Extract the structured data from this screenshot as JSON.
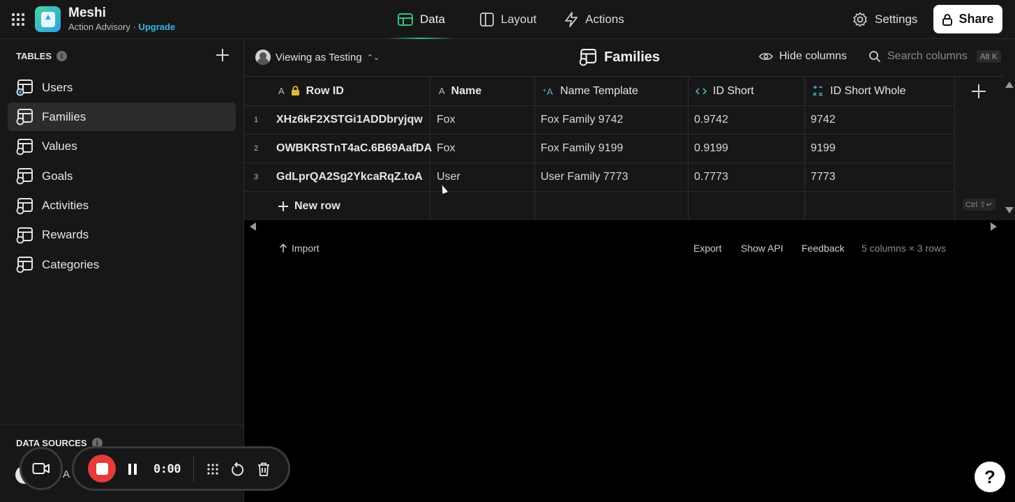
{
  "app": {
    "name": "Meshi",
    "subtitle": "Action Advisory",
    "separator": "·",
    "upgrade": "Upgrade"
  },
  "nav": {
    "data": "Data",
    "layout": "Layout",
    "actions": "Actions",
    "settings": "Settings",
    "share": "Share"
  },
  "sidebar": {
    "tables_label": "TABLES",
    "info": "i",
    "tables": [
      {
        "label": "Users"
      },
      {
        "label": "Families",
        "active": true
      },
      {
        "label": "Values"
      },
      {
        "label": "Goals"
      },
      {
        "label": "Activities"
      },
      {
        "label": "Rewards"
      },
      {
        "label": "Categories"
      }
    ],
    "data_sources_label": "DATA SOURCES",
    "data_source_name": "on A"
  },
  "toolbar": {
    "viewing_as": "Viewing as Testing",
    "updown": "⌃⌄",
    "title": "Families",
    "hide_columns": "Hide columns",
    "search_placeholder": "Search columns",
    "search_shortcut": "Alt K"
  },
  "grid": {
    "columns": [
      {
        "label": "Row ID"
      },
      {
        "label": "Name"
      },
      {
        "label": "Name Template"
      },
      {
        "label": "ID Short"
      },
      {
        "label": "ID Short Whole"
      }
    ],
    "rows": [
      {
        "num": "1",
        "cells": [
          "XHz6kF2XSTGi1ADDbryjqw",
          "Fox",
          "Fox Family 9742",
          "0.9742",
          "9742"
        ]
      },
      {
        "num": "2",
        "cells": [
          "OWBKRSTnT4aC.6B69AafDA",
          "Fox",
          "Fox Family 9199",
          "0.9199",
          "9199"
        ]
      },
      {
        "num": "3",
        "cells": [
          "GdLprQA2Sg2YkcaRqZ.toA",
          "User",
          "User Family 7773",
          "0.7773",
          "7773"
        ]
      }
    ],
    "new_row": "New row",
    "ctrl_hint": "Ctrl ⇧↵"
  },
  "footer": {
    "import": "Import",
    "export": "Export",
    "show_api": "Show API",
    "feedback": "Feedback",
    "summary": "5 columns × 3 rows"
  },
  "recorder": {
    "time": "0:00"
  },
  "help": "?",
  "colors": {
    "accent_green": "#2fc483",
    "upgrade_blue": "#35b8e6",
    "record_red": "#e63b3b"
  }
}
